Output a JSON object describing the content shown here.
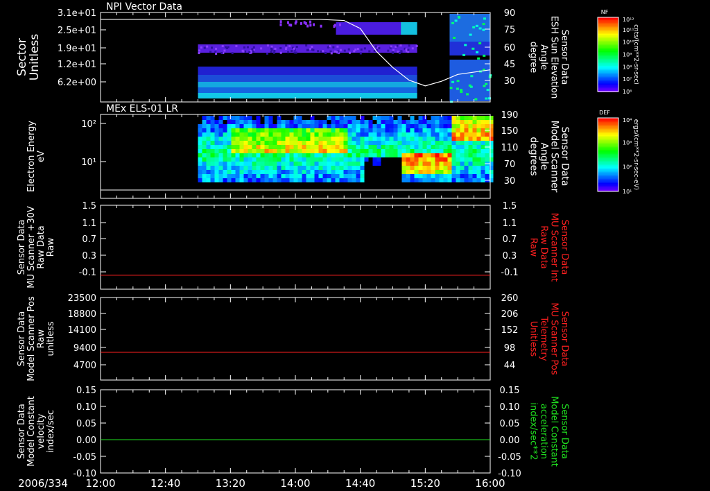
{
  "footer": {
    "date_label": "2006/334"
  },
  "time_ticks": [
    "12:00",
    "12:40",
    "13:20",
    "14:00",
    "14:40",
    "15:20",
    "16:00"
  ],
  "colorbars": [
    {
      "title": "NF",
      "tick_top": "10¹²",
      "tick_labels": [
        "10¹¹",
        "10¹⁰",
        "10⁹",
        "10⁸",
        "10⁷"
      ],
      "tick_bottom": "10⁶",
      "unit": "cnts/(cm**2-sr-sec)"
    },
    {
      "title": "DEF",
      "tick_top": "10⁴",
      "tick_labels": [
        "10³",
        "10²"
      ],
      "tick_bottom": "10¹",
      "unit": "ergs/(cm**2-sr-sec-eV)"
    }
  ],
  "chart_data": [
    {
      "type": "heatmap",
      "title": "NPI Vector Data",
      "ylabel": [
        "Sector",
        "Unitless"
      ],
      "yticks": [
        "3.1e+01",
        "2.5e+01",
        "1.9e+01",
        "1.2e+01",
        "6.2e+00"
      ],
      "right_ylabel": [
        "Sensor Data",
        "ESH Sun Elevation",
        "Angle",
        "degree"
      ],
      "right_yticks": [
        "90",
        "75",
        "60",
        "45",
        "30"
      ],
      "right_ylim": [
        15,
        90
      ],
      "xlim": [
        "12:00",
        "16:00"
      ],
      "overlay_line": {
        "name": "ESH Sun Elevation Angle",
        "x": [
          "12:00",
          "13:00",
          "14:00",
          "14:15",
          "14:30",
          "14:40",
          "14:50",
          "15:00",
          "15:10",
          "15:20",
          "15:30",
          "15:40",
          "16:00"
        ],
        "y": [
          84,
          84,
          84,
          84,
          83,
          76,
          56,
          42,
          31,
          26,
          30,
          36,
          40
        ]
      }
    },
    {
      "type": "heatmap",
      "title": "MEx ELS-01 LR",
      "ylabel": [
        "Electron Energy",
        "eV"
      ],
      "yticks": [
        "10²",
        "10¹"
      ],
      "ylim": [
        1,
        200
      ],
      "right_ylabel": [
        "Sensor Data",
        "Model Scanner",
        "Angle",
        "degrees"
      ],
      "right_yticks": [
        "190",
        "150",
        "110",
        "70",
        "30"
      ],
      "right_ylim": [
        10,
        190
      ],
      "xlim": [
        "12:00",
        "16:00"
      ],
      "overlay_line": {
        "name": "Model Scanner Angle",
        "x": [
          "12:00",
          "16:00"
        ],
        "y": [
          15,
          15
        ]
      }
    },
    {
      "type": "line",
      "ylabel": [
        "Sensor Data",
        "MU Scanner +30V",
        "Raw Data",
        "Raw"
      ],
      "yticks": [
        "1.5",
        "1.1",
        "0.7",
        "0.3",
        "-0.1"
      ],
      "ylim": [
        -0.3,
        1.5
      ],
      "right_ylabel": [
        "Sensor Data",
        "MU Scanner Int",
        "Raw Data",
        "Raw"
      ],
      "right_yticks": [
        "1.5",
        "1.1",
        "0.7",
        "0.3",
        "-0.1"
      ],
      "right_color": "#ff2020",
      "series": [
        {
          "color": "#ff2020",
          "x": [
            "12:00",
            "16:00"
          ],
          "y": [
            0.0,
            0.0
          ]
        }
      ]
    },
    {
      "type": "line",
      "ylabel": [
        "Sensor Data",
        "Model Scanner Pos",
        "Raw",
        "unitless"
      ],
      "yticks": [
        "23500",
        "18800",
        "14100",
        "9400",
        "4700"
      ],
      "ylim": [
        0,
        23500
      ],
      "right_ylabel": [
        "Sensor Data",
        "MU Scanner Pos",
        "Telemetry",
        "Unitless"
      ],
      "right_yticks": [
        "260",
        "206",
        "152",
        "98",
        "44"
      ],
      "right_color": "#ff2020",
      "series": [
        {
          "color": "#ff2020",
          "x": [
            "12:00",
            "16:00"
          ],
          "y": [
            7900,
            7900
          ]
        }
      ]
    },
    {
      "type": "line",
      "ylabel": [
        "Sensor Data",
        "Model Constant",
        "velocity",
        "index/sec"
      ],
      "yticks": [
        "0.15",
        "0.10",
        "0.05",
        "0.00",
        "-0.05",
        "-0.10"
      ],
      "ylim": [
        -0.1,
        0.15
      ],
      "right_ylabel": [
        "Sensor Data",
        "Model Constant",
        "acceleration",
        "index/sec**2"
      ],
      "right_yticks": [
        "0.15",
        "0.10",
        "0.05",
        "0.00",
        "-0.05",
        "-0.10"
      ],
      "right_color": "#20e020",
      "series": [
        {
          "color": "#20e020",
          "x": [
            "12:00",
            "16:00"
          ],
          "y": [
            0.0,
            0.0
          ]
        }
      ]
    }
  ]
}
